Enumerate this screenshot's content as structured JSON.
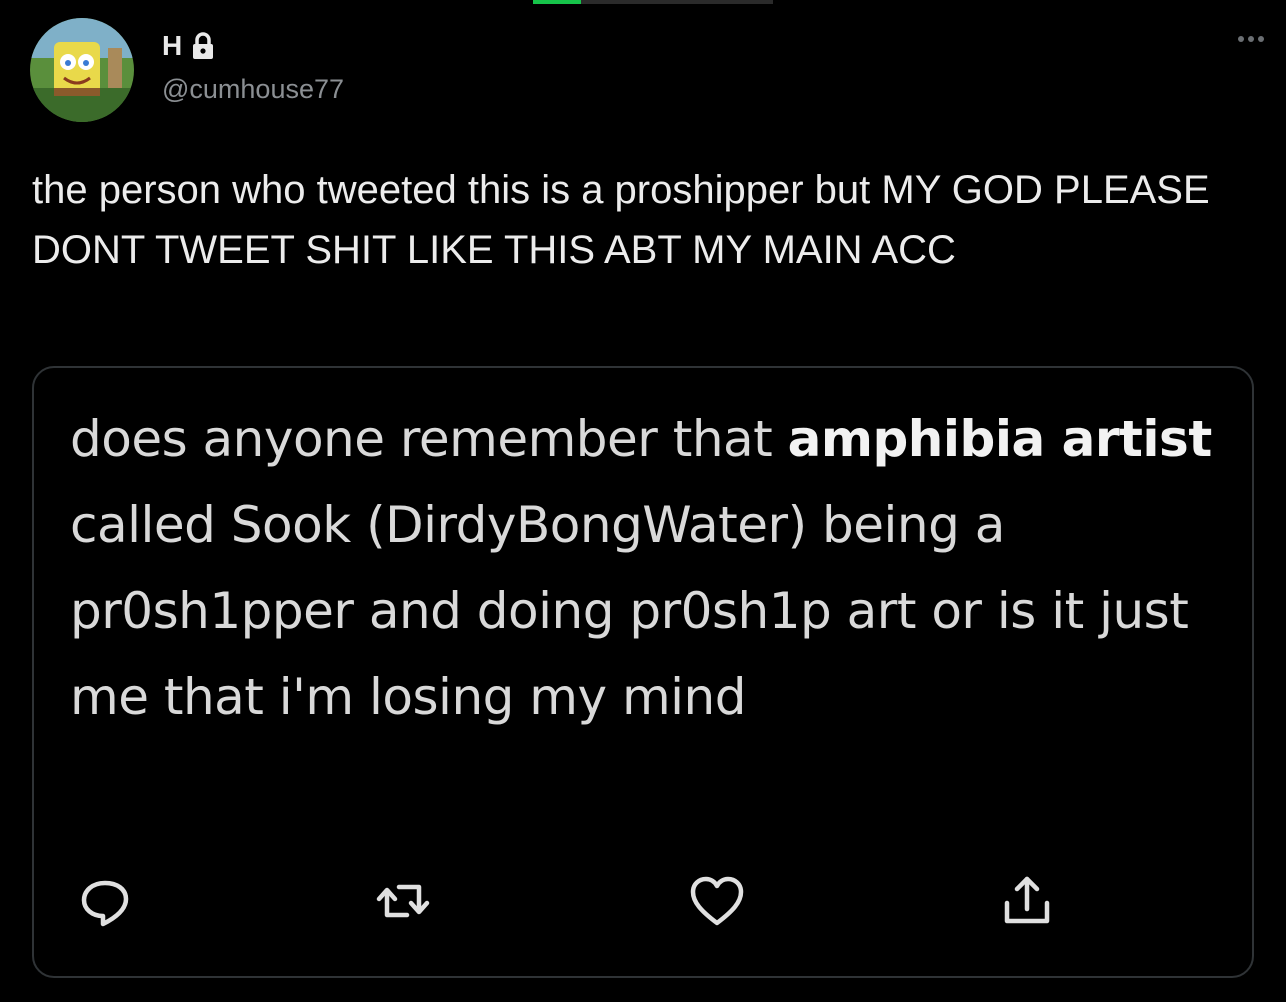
{
  "author": {
    "display_name": "H",
    "handle": "@cumhouse77",
    "avatar_icon": "spongebob-avatar",
    "protected_icon": "lock-icon"
  },
  "tweet": {
    "text": "the person who tweeted this is a proshipper but MY GOD PLEASE DONT TWEET SHIT LIKE THIS ABT MY MAIN ACC"
  },
  "quoted_tweet": {
    "segments": [
      {
        "text": "does anyone remember that ",
        "bold": false
      },
      {
        "text": "amphibia artist",
        "bold": true
      },
      {
        "text": " called Sook (DirdyBongWater) being a pr0sh1pper and doing pr0sh1p art or is it just me that i'm losing my mind",
        "bold": false
      }
    ]
  },
  "actions": [
    {
      "name": "reply-button",
      "icon": "reply-icon"
    },
    {
      "name": "retweet-button",
      "icon": "retweet-icon"
    },
    {
      "name": "like-button",
      "icon": "heart-icon"
    },
    {
      "name": "share-button",
      "icon": "share-icon"
    }
  ],
  "colors": {
    "background": "#000000",
    "text": "#e7e9ea",
    "muted": "#8b8f93",
    "border": "#2f3336",
    "progress_accent": "#16c34a"
  }
}
